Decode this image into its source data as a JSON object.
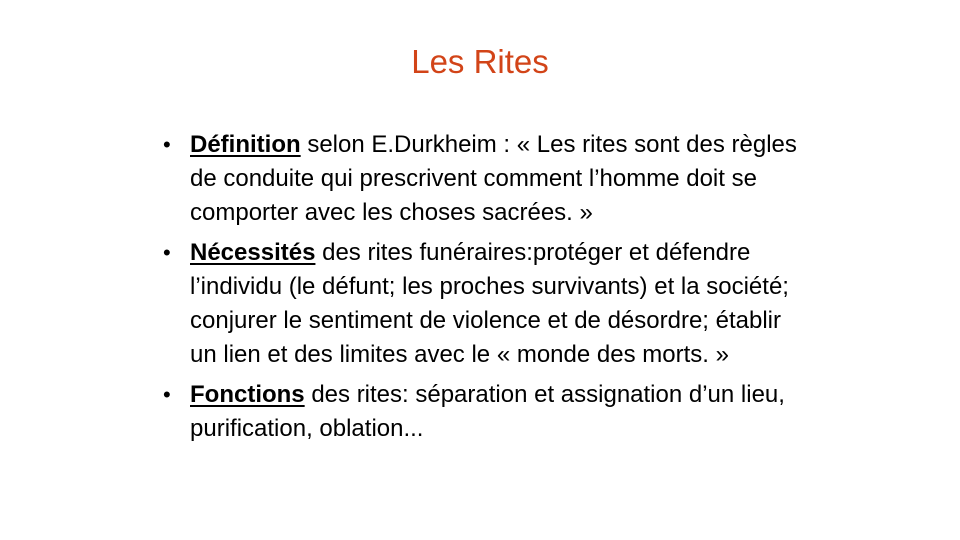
{
  "slide": {
    "title": "Les Rites",
    "bullets": [
      {
        "term": "Définition",
        "text": " selon E.Durkheim : « Les rites sont des règles de conduite qui prescrivent comment l’homme doit se comporter avec les choses sacrées. »"
      },
      {
        "term": "Nécessités",
        "text": " des rites funéraires:protéger et défendre l’individu (le défunt; les proches survivants) et la société; conjurer le sentiment de violence et de désordre; établir un lien et des limites avec le « monde  des morts. »"
      },
      {
        "term": "Fonctions",
        "text": " des rites: séparation et assignation d’un lieu, purification, oblation..."
      }
    ],
    "bullet_glyph": "•",
    "colors": {
      "title": "#d24418",
      "text": "#000000",
      "background": "#ffffff"
    }
  }
}
